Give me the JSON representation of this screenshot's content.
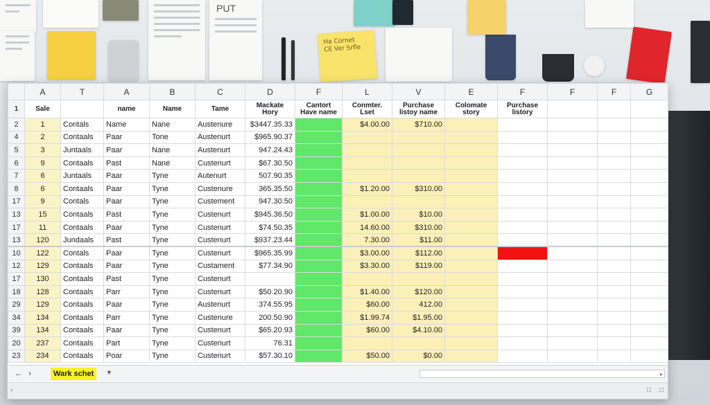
{
  "sheet": {
    "column_letters": [
      "",
      "A",
      "T",
      "A",
      "B",
      "C",
      "D",
      "F",
      "L",
      "V",
      "E",
      "F",
      "F",
      "F",
      "G"
    ],
    "header_row": {
      "row_num": "1",
      "cells": [
        "Sale",
        "",
        "name",
        "Name",
        "Tame",
        "Mackate Hory",
        "Cantort Have name",
        "Conmter. Lset",
        "Purchase listoy name",
        "Colomate story",
        "Purchase listory",
        "",
        "",
        ""
      ]
    },
    "rows": [
      {
        "n": "2",
        "a": "1",
        "t": "Contals",
        "name": "Name",
        "b": "Nane",
        "c": "Austenure",
        "d": "$3447.35.33",
        "l": "$4.00.00",
        "v": "$710.00",
        "red": false
      },
      {
        "n": "4",
        "a": "2",
        "t": "Contaals",
        "name": "Paar",
        "b": "Tone",
        "c": "Austenurt",
        "d": "$965.90.37",
        "l": "",
        "v": "",
        "red": false
      },
      {
        "n": "5",
        "a": "3",
        "t": "Juntaals",
        "name": "Paar",
        "b": "Nane",
        "c": "Austenurt",
        "d": "947.24.43",
        "l": "",
        "v": "",
        "red": false
      },
      {
        "n": "6",
        "a": "9",
        "t": "Contaals",
        "name": "Past",
        "b": "Nane",
        "c": "Custenurt",
        "d": "$67.30.50",
        "l": "",
        "v": "",
        "red": false
      },
      {
        "n": "7",
        "a": "6",
        "t": "Juntaals",
        "name": "Paar",
        "b": "Tyne",
        "c": "Autenurt",
        "d": "507.90.35",
        "l": "",
        "v": "",
        "red": false
      },
      {
        "n": "8",
        "a": "6",
        "t": "Contaals",
        "name": "Paar",
        "b": "Tyne",
        "c": "Custenure",
        "d": "365.35.50",
        "l": "$1.20.00",
        "v": "$310.00",
        "red": false
      },
      {
        "n": "17",
        "a": "9",
        "t": "Contals",
        "name": "Paar",
        "b": "Tyne",
        "c": "Custement",
        "d": "947.30.50",
        "l": "",
        "v": "",
        "red": false
      },
      {
        "n": "13",
        "a": "15",
        "t": "Contaals",
        "name": "Past",
        "b": "Tyne",
        "c": "Custenurt",
        "d": "$945.36.50",
        "l": "$1.00.00",
        "v": "$10.00",
        "red": false
      },
      {
        "n": "17",
        "a": "11",
        "t": "Contaals",
        "name": "Paar",
        "b": "Tyne",
        "c": "Custenurt",
        "d": "$74.50.35",
        "l": "14.60.00",
        "v": "$310.00",
        "red": false
      },
      {
        "n": "13",
        "a": "120",
        "t": "Jundaals",
        "name": "Past",
        "b": "Tyne",
        "c": "Custenurt",
        "d": "$937.23.44",
        "l": "7.30.00",
        "v": "$11.00",
        "red": false
      },
      {
        "n": "10",
        "a": "122",
        "t": "Contals",
        "name": "Paar",
        "b": "Tyne",
        "c": "Custenurt",
        "d": "$965.35.99",
        "l": "$3.00.00",
        "v": "$112.00",
        "red": true
      },
      {
        "n": "12",
        "a": "129",
        "t": "Contaals",
        "name": "Paar",
        "b": "Tyne",
        "c": "Custament",
        "d": "$77.34.90",
        "l": "$3.30.00",
        "v": "$119.00",
        "red": false
      },
      {
        "n": "17",
        "a": "130",
        "t": "Contaals",
        "name": "Past",
        "b": "Tyne",
        "c": "Custenurt",
        "d": "",
        "l": "",
        "v": "",
        "red": false
      },
      {
        "n": "18",
        "a": "128",
        "t": "Contaals",
        "name": "Parr",
        "b": "Tyne",
        "c": "Custenurt",
        "d": "$50.20.90",
        "l": "$1.40.00",
        "v": "$120.00",
        "red": false
      },
      {
        "n": "29",
        "a": "129",
        "t": "Contaals",
        "name": "Paar",
        "b": "Tyne",
        "c": "Austenurt",
        "d": "374.55.95",
        "l": "$60.00",
        "v": "412.00",
        "red": false
      },
      {
        "n": "34",
        "a": "134",
        "t": "Contaals",
        "name": "Parr",
        "b": "Tyne",
        "c": "Custenure",
        "d": "200.50.90",
        "l": "$1.99.74",
        "v": "$1.95.00",
        "red": false
      },
      {
        "n": "39",
        "a": "134",
        "t": "Contaals",
        "name": "Paar",
        "b": "Tyne",
        "c": "Custenurt",
        "d": "$65.20.93",
        "l": "$60.00",
        "v": "$4.10.00",
        "red": false
      },
      {
        "n": "20",
        "a": "237",
        "t": "Contaals",
        "name": "Part",
        "b": "Tyne",
        "c": "Custenurt",
        "d": "76.31",
        "l": "",
        "v": "",
        "red": false
      },
      {
        "n": "23",
        "a": "234",
        "t": "Contaals",
        "name": "Poar",
        "b": "Tyne",
        "c": "Custenurt",
        "d": "$57.30.10",
        "l": "$50.00",
        "v": "$0.00",
        "red": false
      }
    ]
  },
  "tabs": {
    "prev_icon": "left-arrow-icon",
    "next_icon": "right-arrow-icon",
    "active_tab": "Wark schet",
    "caret_icon": "chevron-down-icon"
  },
  "background": {
    "sticky_text": "Ha Cornet CE Ver Srfle",
    "poster_text": "PUT"
  },
  "colors": {
    "green_fill": "#61e76a",
    "yellow_fill": "#fbf0b8",
    "red_fill": "#f0130f",
    "tab_highlight": "#f7f12a"
  }
}
